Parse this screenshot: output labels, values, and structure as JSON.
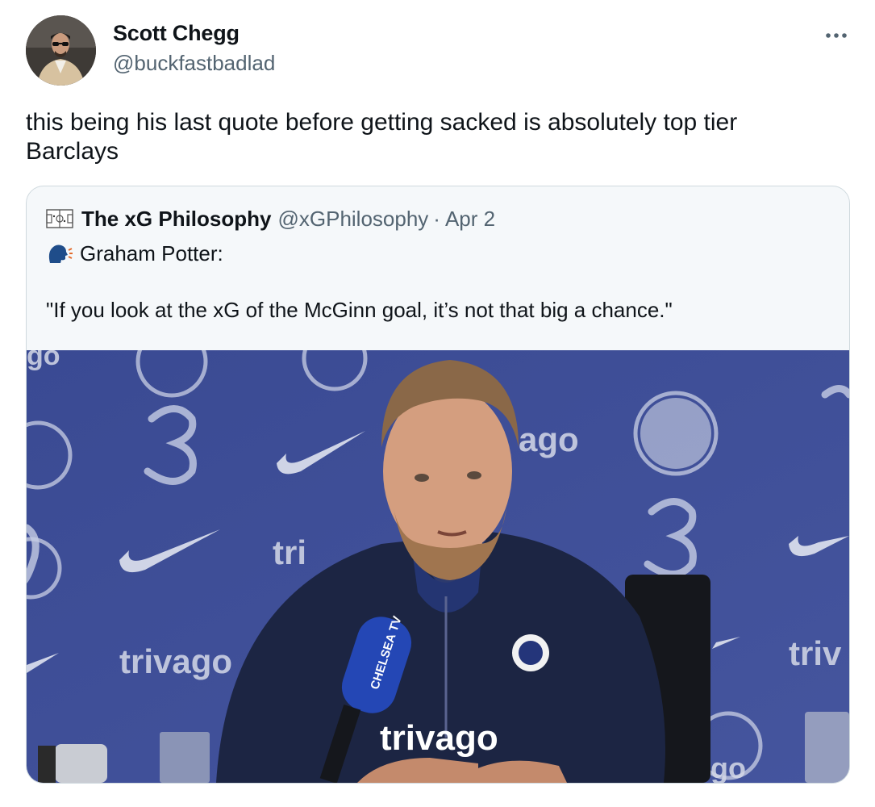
{
  "author": {
    "name": "Scott Chegg",
    "handle": "@buckfastbadlad",
    "avatar_icon": "profile-photo"
  },
  "tweet": {
    "text_line1": "this being his last quote before getting sacked is absolutely top tier",
    "text_line2": "Barclays"
  },
  "more_icon": "more-horizontal-icon",
  "quoted": {
    "name": "The xG Philosophy",
    "handle": "@xGPhilosophy",
    "separator": "·",
    "date": "Apr 2",
    "speaker": "Graham Potter:",
    "quote": "\"If you look at the xG of the McGinn goal, it’s not that big a chance.\"",
    "speaker_icon": "speaking-head-icon",
    "media": {
      "description_icon": "press-conference-photo",
      "backdrop_texts": [
        "trivago",
        "tri",
        "ago",
        "triv",
        "go",
        "go"
      ],
      "shirt_text": "trivago",
      "mic_text": "CHELSEA TV",
      "colors": {
        "backdrop": "#3d4d96",
        "jacket": "#1c2543"
      }
    }
  }
}
